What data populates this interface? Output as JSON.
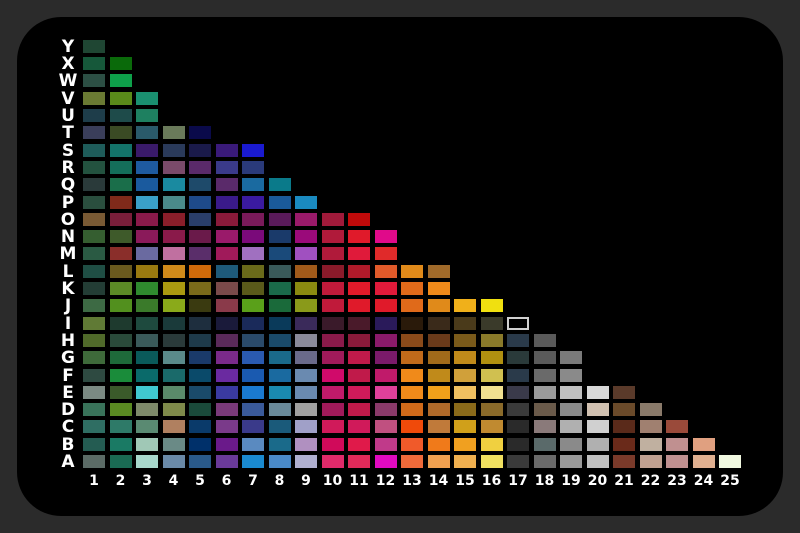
{
  "row_labels": [
    "A",
    "B",
    "C",
    "D",
    "E",
    "F",
    "G",
    "H",
    "I",
    "J",
    "K",
    "L",
    "M",
    "N",
    "O",
    "P",
    "Q",
    "R",
    "S",
    "T",
    "U",
    "V",
    "W",
    "X",
    "Y"
  ],
  "column_labels": [
    "1",
    "2",
    "3",
    "4",
    "5",
    "6",
    "7",
    "8",
    "9",
    "10",
    "11",
    "12",
    "13",
    "14",
    "15",
    "16",
    "17",
    "18",
    "19",
    "20",
    "21",
    "22",
    "23",
    "24",
    "25"
  ],
  "selected_cell": {
    "row": "I",
    "column": "17"
  },
  "column_colors": [
    [
      "#5b6b66",
      "#245c52",
      "#2f6e63",
      "#39735a",
      "#7b8a83",
      "#2e4a41",
      "#3e6a3a",
      "#506a2a",
      "#607a35",
      "#3d6a44",
      "#233d35",
      "#1f4e44",
      "#2a5a43",
      "#355e30",
      "#7a5a34",
      "#2a4e3e",
      "#2a3a3a",
      "#23523f",
      "#1e5c5a",
      "#3a3e5a",
      "#1e3d4a",
      "#6a7a33",
      "#2c4f44",
      "#16583a",
      "#1f4633"
    ],
    [
      "#1a6a53",
      "#1a7a64",
      "#2e7a68",
      "#5a8a22",
      "#3a5a2a",
      "#1a8c3a",
      "#1e6a3a",
      "#2a4a3a",
      "#1e3a2e",
      "#52901e",
      "#5b8a26",
      "#6a5a1e",
      "#8a2e2a",
      "#3e5a2a",
      "#7a1e3a",
      "#802a1a",
      "#1a6e4a",
      "#146e5a",
      "#13736a",
      "#3a4a24",
      "#1e4b4a",
      "#5a8a1a",
      "#0ea04a",
      "#0a6a0a"
    ],
    [
      "#a8d8cc",
      "#a0c8b6",
      "#5a8a72",
      "#7e8a6a",
      "#40c8d0",
      "#0a6a6a",
      "#0a5a5a",
      "#3a5a5a",
      "#1e4a3e",
      "#3a7a2a",
      "#2f8a2e",
      "#9a7a10",
      "#6a6aa0",
      "#8a1a5a",
      "#8a1a4a",
      "#3aa0c8",
      "#1a5a9e",
      "#1e5aa0",
      "#3a1a6a",
      "#2a5a6a",
      "#1e8060",
      "#1a9070"
    ],
    [
      "#6a8aa8",
      "#6a8a86",
      "#b08060",
      "#7e8a4a",
      "#5a8a6a",
      "#1a6a6a",
      "#5a8a8a",
      "#2a3a3a",
      "#1a3a3a",
      "#8aaa1a",
      "#aa9a10",
      "#d08a1a",
      "#c070a0",
      "#8a1a4a",
      "#8a1e2a",
      "#4a8a8a",
      "#1a8aa0",
      "#7a4a6a",
      "#2a3a5a",
      "#6a7a5a"
    ],
    [
      "#2a5a8a",
      "#00306a",
      "#0a3a6a",
      "#1a4a3a",
      "#1a4a6a",
      "#0a4a6a",
      "#1a3a6a",
      "#1e3a4a",
      "#1e2e3e",
      "#3a3a10",
      "#7a6a1a",
      "#d06a0a",
      "#5a2e6a",
      "#6a1a4a",
      "#2a3e6a",
      "#1e4a8a",
      "#1e4a6a",
      "#5a2a6a",
      "#1a1a4a",
      "#0a0a4a"
    ],
    [
      "#6a3a9a",
      "#6a1a8a",
      "#7a3a8a",
      "#7a3a7a",
      "#3a3aa0",
      "#6a2aa0",
      "#7a2a8a",
      "#5a2a5a",
      "#1a1a3a",
      "#8a3a4a",
      "#7a4a4a",
      "#1e5a7a",
      "#a01a5a",
      "#9a1a6a",
      "#8a1a3a",
      "#3a1a8a",
      "#5a2a6a",
      "#3a3a8a",
      "#3a1a7a"
    ],
    [
      "#1a8ad0",
      "#5a8ac0",
      "#3a3a8a",
      "#3a5a9a",
      "#1a7ad0",
      "#1a5ab0",
      "#2a5ab0",
      "#2a4a6a",
      "#1a2a5a",
      "#5aa01a",
      "#5a5a1a",
      "#6a6a1a",
      "#a070c0",
      "#7a0a7a",
      "#7a1a5a",
      "#3a1aa0",
      "#1a6aa0",
      "#2a3a7a",
      "#1a1ad0"
    ],
    [
      "#4a8ac8",
      "#1a6a8a",
      "#1a5a7a",
      "#6a8a9a",
      "#1a8ab0",
      "#1a6aa0",
      "#1a6a8a",
      "#1a4a6a",
      "#0a3a5a",
      "#1a6a3a",
      "#1a6a4a",
      "#3a5a5a",
      "#1a4a7a",
      "#1a3a6a",
      "#5a1a5a",
      "#1a5a9a",
      "#0a7a8a"
    ],
    [
      "#b0b0d0",
      "#b090c0",
      "#a0a0c8",
      "#a0a0a0",
      "#6a8ab0",
      "#6a8ab0",
      "#6a6a8a",
      "#8a8a9a",
      "#3a2a5a",
      "#8a9a1a",
      "#8a8a10",
      "#a05a1a",
      "#a050c0",
      "#9a0a7a",
      "#9a1a6a",
      "#1a8ac0"
    ],
    [
      "#e02a6a",
      "#d00a5a",
      "#d01a5a",
      "#a01a5a",
      "#c01a6a",
      "#d00a6a",
      "#a01a5a",
      "#8a1a4a",
      "#3a1a2a",
      "#c01a3a",
      "#c01a3a",
      "#8a1a2a",
      "#b01a3a",
      "#b01a3a",
      "#a01a3a"
    ],
    [
      "#e02a5a",
      "#e01a4a",
      "#d01a5a",
      "#c01a4a",
      "#d01a5a",
      "#c01a4a",
      "#c01a4a",
      "#8a1a3a",
      "#4a1a2a",
      "#e01a2a",
      "#e01a2a",
      "#b01a2a",
      "#e01a3a",
      "#e01a2a",
      "#c00a0a"
    ],
    [
      "#e00ac0",
      "#c03a8a",
      "#c05080",
      "#8a3a6a",
      "#e0409a",
      "#c01a6a",
      "#7a1a6a",
      "#8a1a6a",
      "#2a1a5a",
      "#e01a2a",
      "#e01a3a",
      "#e05a2a",
      "#e02a2a",
      "#e00a8a"
    ],
    [
      "#f06a3a",
      "#f05a2a",
      "#f04a0a",
      "#d06a1a",
      "#f08a1a",
      "#f08a1a",
      "#c06a1a",
      "#8a4a1a",
      "#2a1a0a",
      "#e06a1a",
      "#e06a1a",
      "#e08a1a"
    ],
    [
      "#f0a050",
      "#f07a1a",
      "#c07a3a",
      "#b06a2a",
      "#f0a01a",
      "#c08a1a",
      "#a06a1a",
      "#6a3a1a",
      "#3a2a1a",
      "#e08a1a",
      "#f08a1a",
      "#a06a2a"
    ],
    [
      "#f0b050",
      "#f0a020",
      "#d0a01a",
      "#8a6a1a",
      "#f0c060",
      "#d0a03a",
      "#c08a1a",
      "#7a5a1a",
      "#4a3a1a",
      "#f0b01a"
    ],
    [
      "#f0e060",
      "#f0d040",
      "#c08a30",
      "#8a6a2a",
      "#f0e090",
      "#d0c050",
      "#b09010",
      "#8a7a2a",
      "#3a3a2a",
      "#f0e010"
    ],
    [
      "#3a3a3a",
      "#2a2a2a",
      "#2a2a2a",
      "#3a3a3a",
      "#3a3a4a",
      "#2a3a4a",
      "#2a3a3a",
      "#2a3a4a",
      "#1e2a3a"
    ],
    [
      "#6a6a6a",
      "#5a6a6a",
      "#8a7a7a",
      "#6a5a4a",
      "#9a9a9a",
      "#6a6a6a",
      "#5a5a5a",
      "#5a5a5a"
    ],
    [
      "#9a9a9a",
      "#8a8a8a",
      "#b0b0b0",
      "#8a8a8a",
      "#c0c0c0",
      "#8a8a8a",
      "#7a7a7a"
    ],
    [
      "#c0c0c0",
      "#b0b0b0",
      "#d0d0d0",
      "#d0c0b0",
      "#d8d8d8"
    ],
    [
      "#7a3a2a",
      "#6a2a1a",
      "#5a2a1a",
      "#6a4a2a",
      "#5a3a2a"
    ],
    [
      "#c0a090",
      "#c0b0a0",
      "#a08070",
      "#8a7a6a"
    ],
    [
      "#c09090",
      "#c09090",
      "#9a4a3a"
    ],
    [
      "#e0b090",
      "#e0a080"
    ],
    [
      "#f0f8e0"
    ]
  ]
}
